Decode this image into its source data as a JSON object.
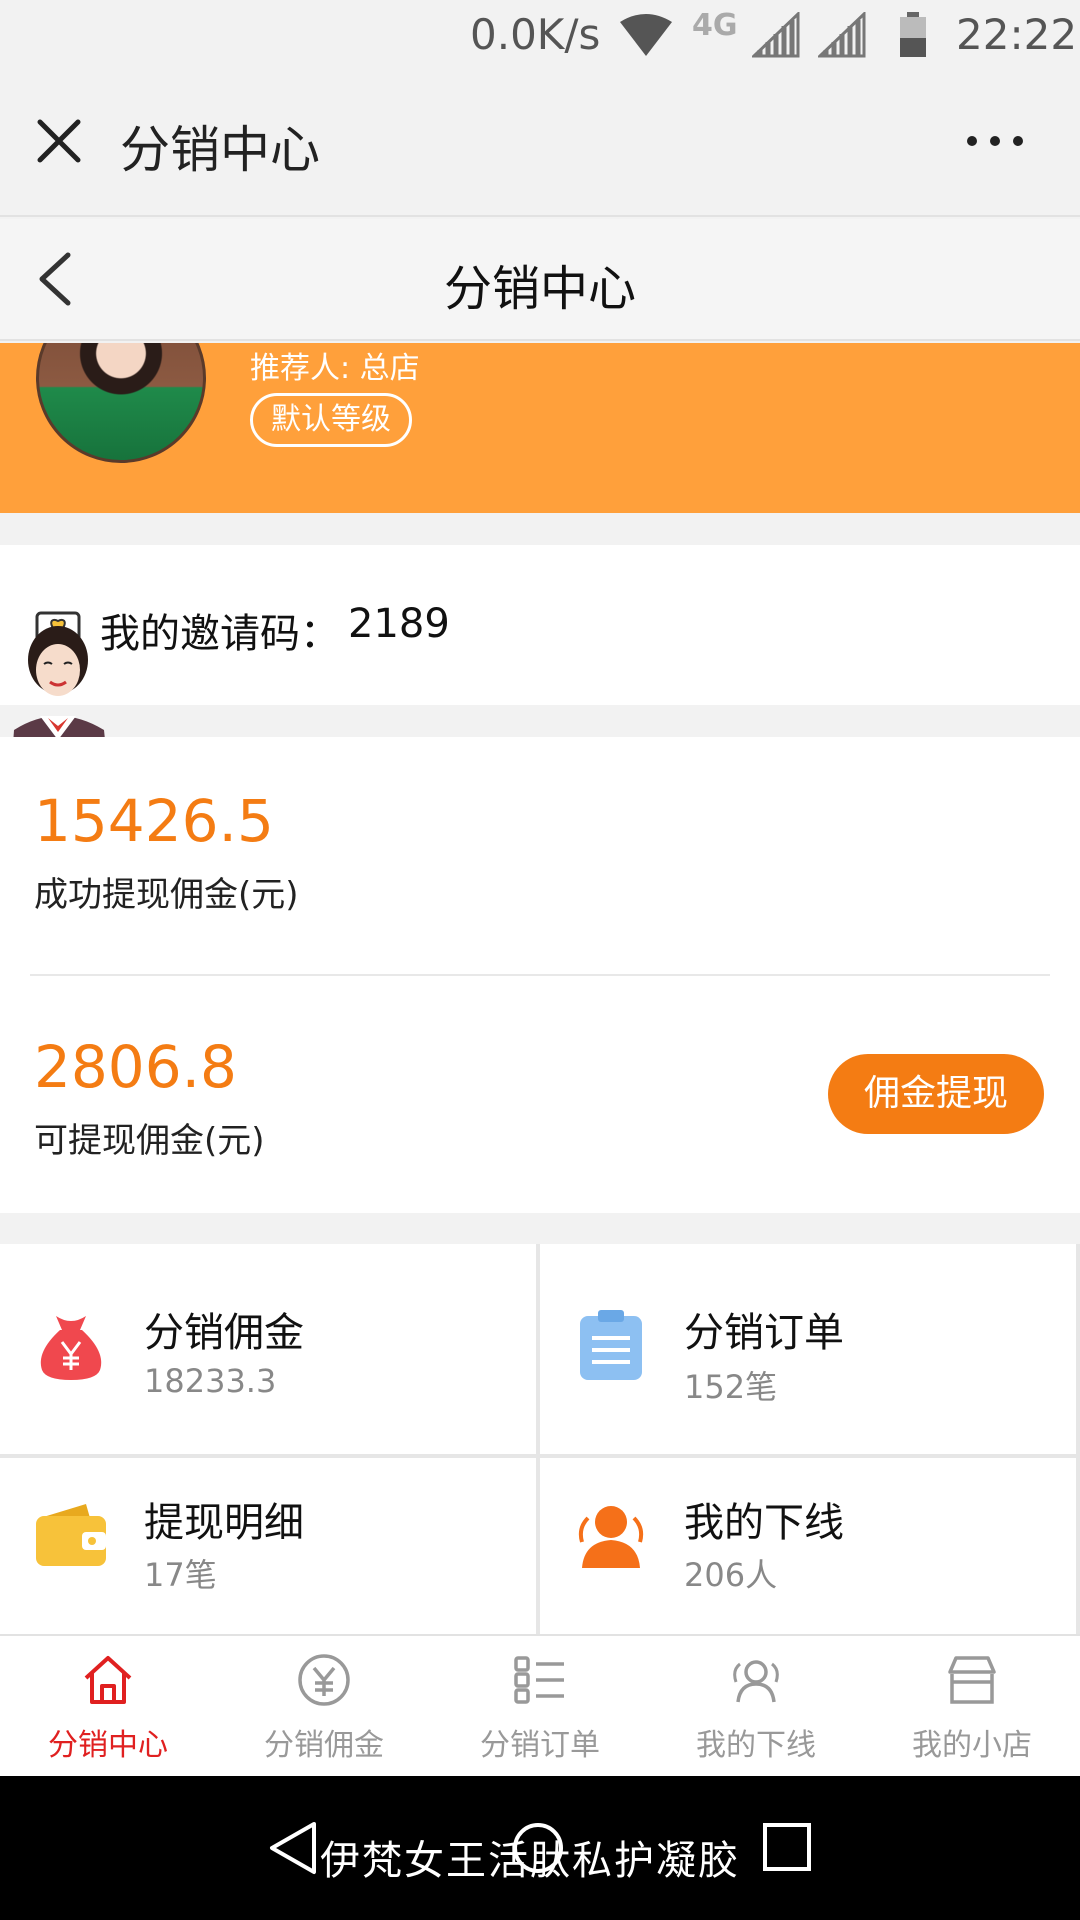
{
  "status_bar": {
    "speed": "0.0K/s",
    "network": "4G",
    "time": "22:22"
  },
  "wechat_bar": {
    "title": "分销中心"
  },
  "header": {
    "title": "分销中心"
  },
  "profile": {
    "referrer": "推荐人: 总店",
    "level": "默认等级"
  },
  "invite": {
    "label": "我的邀请码：",
    "code": "2189"
  },
  "balance": {
    "withdrawn_value": "15426.5",
    "withdrawn_label": "成功提现佣金(元)",
    "available_value": "2806.8",
    "available_label": "可提现佣金(元)",
    "withdraw_button": "佣金提现"
  },
  "grid": [
    {
      "title": "分销佣金",
      "sub": "18233.3",
      "icon": "money-bag-icon",
      "color": "#f0484e"
    },
    {
      "title": "分销订单",
      "sub": "152笔",
      "icon": "clipboard-icon",
      "color": "#7fb6ef"
    },
    {
      "title": "提现明细",
      "sub": "17笔",
      "icon": "wallet-icon",
      "color": "#f7c23a"
    },
    {
      "title": "我的下线",
      "sub": "206人",
      "icon": "team-icon",
      "color": "#f57019"
    }
  ],
  "tabs": [
    {
      "label": "分销中心",
      "icon": "home-icon",
      "active": true
    },
    {
      "label": "分销佣金",
      "icon": "yen-circle-icon",
      "active": false
    },
    {
      "label": "分销订单",
      "icon": "list-icon",
      "active": false
    },
    {
      "label": "我的下线",
      "icon": "people-icon",
      "active": false
    },
    {
      "label": "我的小店",
      "icon": "shop-icon",
      "active": false
    }
  ],
  "nav_overlay": "伊梵女王活肽私护凝胶",
  "colors": {
    "accent_orange": "#f47c13",
    "banner_orange": "#ffa03b",
    "active_tab": "#e02020"
  }
}
